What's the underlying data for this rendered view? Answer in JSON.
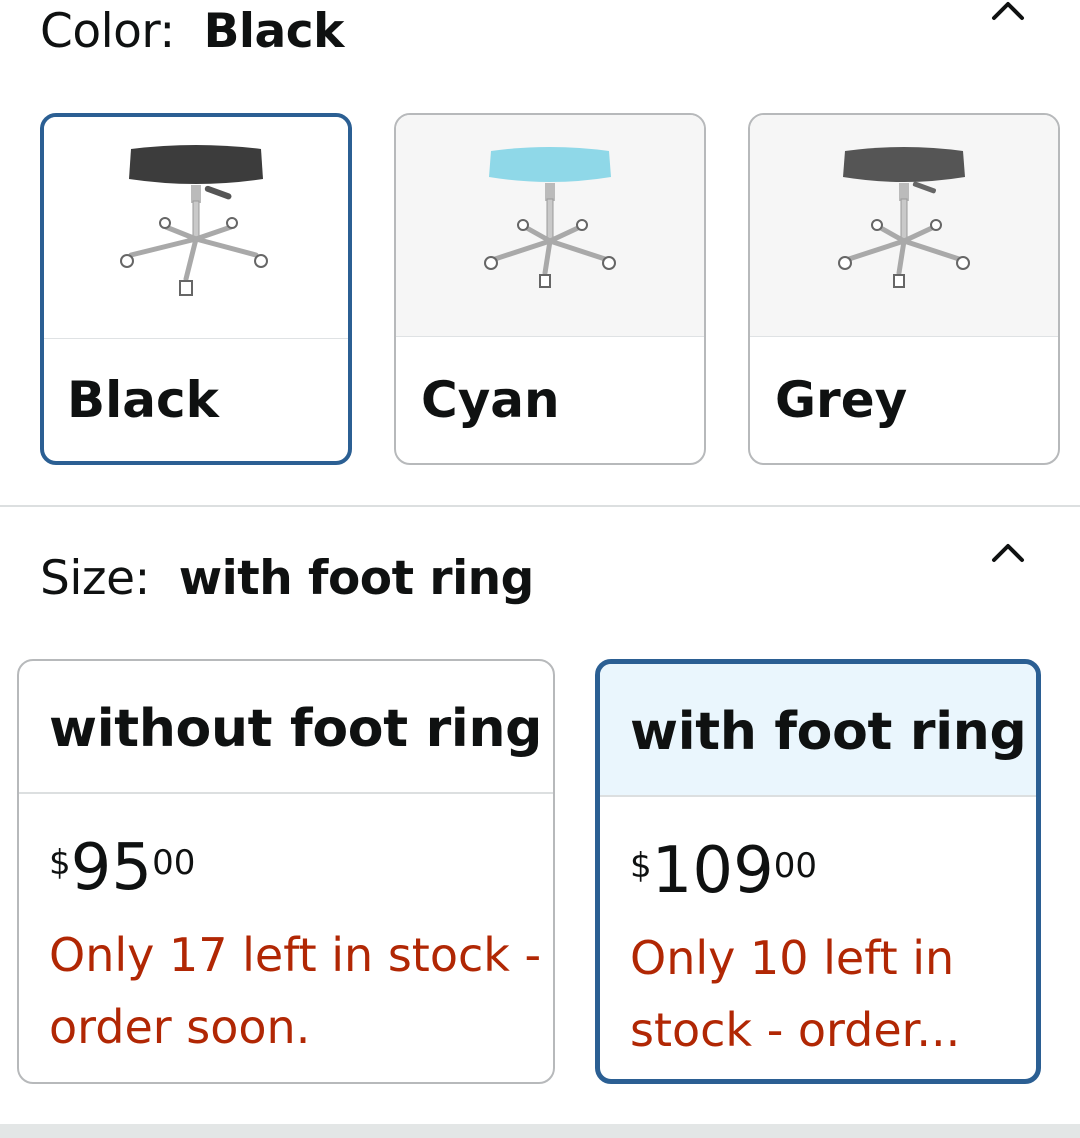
{
  "color_section": {
    "label": "Color:",
    "selected": "Black",
    "collapse_icon": "chevron-up-icon",
    "options": [
      {
        "name": "Black",
        "seat_color": "#3c3c3c",
        "selected": true
      },
      {
        "name": "Cyan",
        "seat_color": "#8fd8e8",
        "selected": false
      },
      {
        "name": "Grey",
        "seat_color": "#555555",
        "selected": false
      }
    ]
  },
  "size_section": {
    "label": "Size:",
    "selected": "with foot ring",
    "collapse_icon": "chevron-up-icon",
    "options": [
      {
        "name": "without foot ring",
        "currency": "$",
        "price_whole": "95",
        "price_fraction": "00",
        "stock": "Only 17 left in stock - order soon.",
        "selected": false
      },
      {
        "name": "with foot ring",
        "currency": "$",
        "price_whole": "109",
        "price_fraction": "00",
        "stock": "Only 10 left in stock - order...",
        "selected": true
      }
    ]
  },
  "colors": {
    "selected_border": "#2b5f93",
    "stock_text": "#b12704",
    "selected_header_bg": "#eaf6fd"
  }
}
